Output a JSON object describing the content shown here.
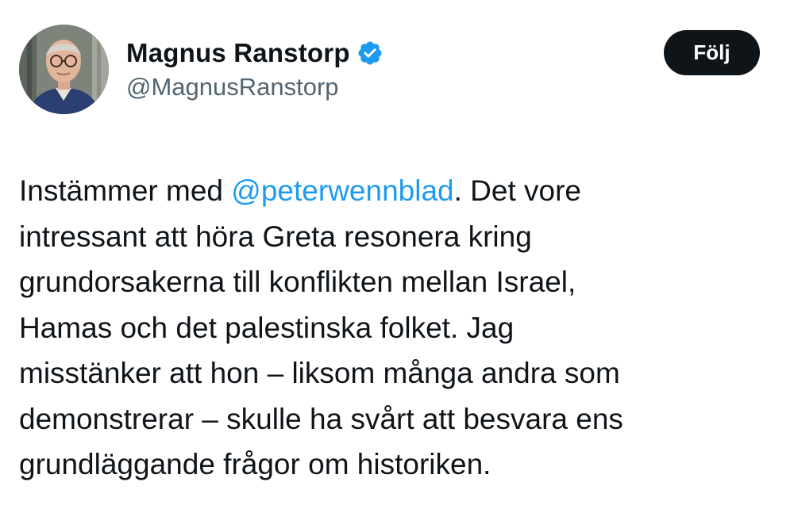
{
  "author": {
    "display_name": "Magnus Ranstorp",
    "handle": "@MagnusRanstorp",
    "verified_icon": "verified-badge-icon",
    "verified_color": "#1d9bf0"
  },
  "follow_button": {
    "label": "Följ"
  },
  "tweet": {
    "line1_before": "Instämmer med ",
    "mention": "@peterwennblad",
    "line1_after": ". Det vore",
    "lines": [
      "intressant att höra Greta resonera kring",
      "grundorsakerna till konflikten mellan Israel,",
      "Hamas och det palestinska folket. Jag",
      "misstänker att hon – liksom många andra som",
      "demonstrerar – skulle ha svårt att besvara ens",
      "grundläggande frågor om historiken."
    ]
  },
  "colors": {
    "text": "#0f1419",
    "secondary_text": "#536471",
    "link": "#1d9bf0",
    "button_bg": "#0f1419",
    "button_text": "#ffffff"
  }
}
